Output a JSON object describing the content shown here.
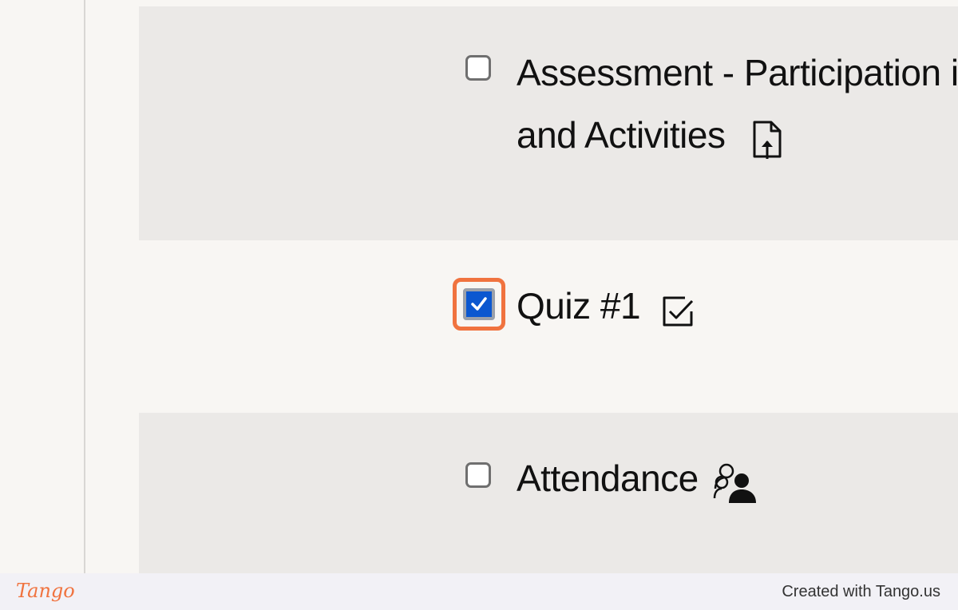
{
  "items": [
    {
      "label_line1": "Assessment - Participation i",
      "label_line2": "and Activities",
      "checked": false,
      "icon": "file-upload-icon"
    },
    {
      "label": "Quiz #1",
      "checked": true,
      "icon": "quiz-check-icon"
    },
    {
      "label": "Attendance",
      "checked": false,
      "icon": "attendance-icon"
    }
  ],
  "footer": {
    "logo": "Tango",
    "credit": "Created with Tango.us"
  },
  "colors": {
    "highlight": "#f0733f",
    "checked_fill": "#0b57d0",
    "row_alt": "#ebe9e7",
    "background": "#f8f6f3"
  }
}
